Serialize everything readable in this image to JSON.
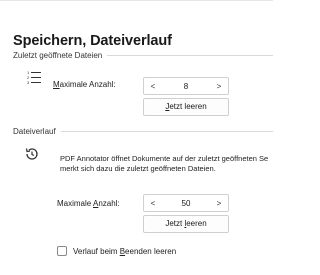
{
  "page": {
    "title": "Speichern, Dateiverlauf"
  },
  "recent_files": {
    "header": "Zuletzt geöffnete Dateien",
    "icon": "numbered-list-icon",
    "max_label_u": "M",
    "max_label_rest": "aximale Anzahl:",
    "stepper": {
      "dec": "<",
      "value": "8",
      "inc": ">"
    },
    "clear_button_u": "J",
    "clear_button_rest": "etzt leeren"
  },
  "history": {
    "header": "Dateiverlauf",
    "icon": "history-icon",
    "description_line1": "PDF Annotator öffnet Dokumente auf der zuletzt geöffneten Se",
    "description_line2": "merkt sich dazu die zuletzt geöffneten Dateien.",
    "max_label_pre": "Maximale ",
    "max_label_u": "A",
    "max_label_rest": "nzahl:",
    "stepper": {
      "dec": "<",
      "value": "50",
      "inc": ">"
    },
    "clear_button_pre": "Jetzt ",
    "clear_button_u": "l",
    "clear_button_rest": "eeren",
    "checkbox_pre": "Verlauf beim ",
    "checkbox_u": "B",
    "checkbox_rest": "eenden leeren",
    "checkbox_checked": false
  }
}
